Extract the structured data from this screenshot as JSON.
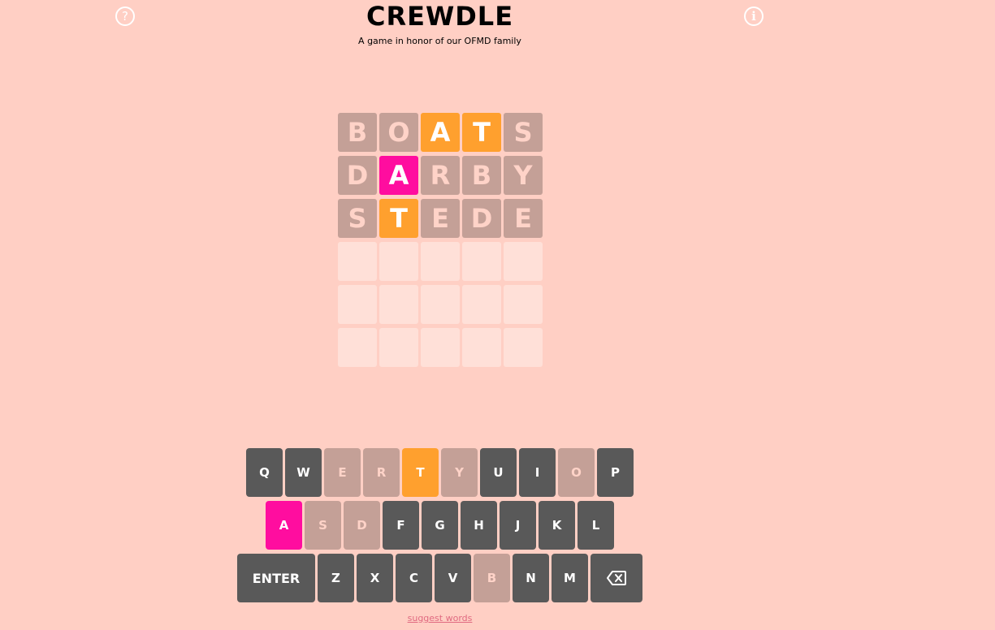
{
  "header": {
    "title": "CREWDLE",
    "subtitle": "A game in honor of our OFMD family",
    "help_icon": "?",
    "info_icon": "i"
  },
  "colors": {
    "background": "#ffcfc4",
    "correct": "#ff0d9f",
    "present": "#ffa02e",
    "absent": "#c4a097",
    "unused_key": "#595959",
    "empty_tile": "#ffe0d8"
  },
  "board": [
    [
      {
        "l": "B",
        "s": "absent"
      },
      {
        "l": "O",
        "s": "absent"
      },
      {
        "l": "A",
        "s": "present"
      },
      {
        "l": "T",
        "s": "present"
      },
      {
        "l": "S",
        "s": "absent"
      }
    ],
    [
      {
        "l": "D",
        "s": "absent"
      },
      {
        "l": "A",
        "s": "correct"
      },
      {
        "l": "R",
        "s": "absent"
      },
      {
        "l": "B",
        "s": "absent"
      },
      {
        "l": "Y",
        "s": "absent"
      }
    ],
    [
      {
        "l": "S",
        "s": "absent"
      },
      {
        "l": "T",
        "s": "present"
      },
      {
        "l": "E",
        "s": "absent"
      },
      {
        "l": "D",
        "s": "absent"
      },
      {
        "l": "E",
        "s": "absent"
      }
    ],
    [
      {
        "l": "",
        "s": "empty"
      },
      {
        "l": "",
        "s": "empty"
      },
      {
        "l": "",
        "s": "empty"
      },
      {
        "l": "",
        "s": "empty"
      },
      {
        "l": "",
        "s": "empty"
      }
    ],
    [
      {
        "l": "",
        "s": "empty"
      },
      {
        "l": "",
        "s": "empty"
      },
      {
        "l": "",
        "s": "empty"
      },
      {
        "l": "",
        "s": "empty"
      },
      {
        "l": "",
        "s": "empty"
      }
    ],
    [
      {
        "l": "",
        "s": "empty"
      },
      {
        "l": "",
        "s": "empty"
      },
      {
        "l": "",
        "s": "empty"
      },
      {
        "l": "",
        "s": "empty"
      },
      {
        "l": "",
        "s": "empty"
      }
    ]
  ],
  "keyboard": [
    [
      {
        "k": "Q",
        "s": "unused"
      },
      {
        "k": "W",
        "s": "unused"
      },
      {
        "k": "E",
        "s": "absent"
      },
      {
        "k": "R",
        "s": "absent"
      },
      {
        "k": "T",
        "s": "present"
      },
      {
        "k": "Y",
        "s": "absent"
      },
      {
        "k": "U",
        "s": "unused"
      },
      {
        "k": "I",
        "s": "unused"
      },
      {
        "k": "O",
        "s": "absent"
      },
      {
        "k": "P",
        "s": "unused"
      }
    ],
    [
      {
        "k": "A",
        "s": "correct"
      },
      {
        "k": "S",
        "s": "absent"
      },
      {
        "k": "D",
        "s": "absent"
      },
      {
        "k": "F",
        "s": "unused"
      },
      {
        "k": "G",
        "s": "unused"
      },
      {
        "k": "H",
        "s": "unused"
      },
      {
        "k": "J",
        "s": "unused"
      },
      {
        "k": "K",
        "s": "unused"
      },
      {
        "k": "L",
        "s": "unused"
      }
    ],
    [
      {
        "k": "ENTER",
        "s": "unused",
        "type": "enter"
      },
      {
        "k": "Z",
        "s": "unused"
      },
      {
        "k": "X",
        "s": "unused"
      },
      {
        "k": "C",
        "s": "unused"
      },
      {
        "k": "V",
        "s": "unused"
      },
      {
        "k": "B",
        "s": "absent"
      },
      {
        "k": "N",
        "s": "unused"
      },
      {
        "k": "M",
        "s": "unused"
      },
      {
        "k": "",
        "s": "unused",
        "type": "backspace",
        "icon": "backspace-icon"
      }
    ]
  ],
  "footer": {
    "suggest_link": "suggest words"
  }
}
